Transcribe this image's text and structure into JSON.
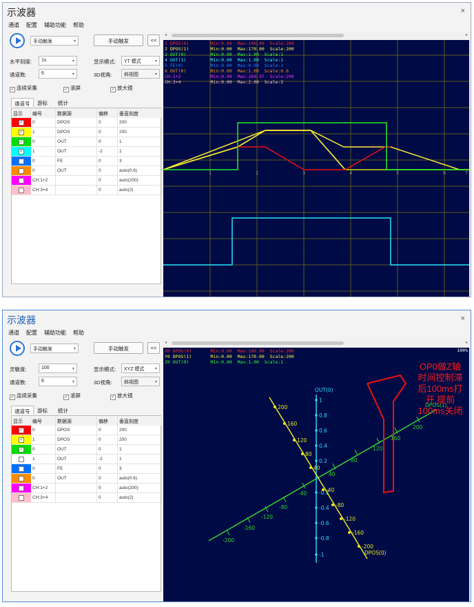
{
  "windows": [
    {
      "title": "示波器",
      "close": "×",
      "menu": [
        "通道",
        "配置",
        "辅助功能",
        "帮助"
      ],
      "trigger_mode": "手动触发",
      "manual_trigger_button": "手动触发",
      "collapse_button": "<<",
      "row1_label": "水平刻度:",
      "row1_value": "1s",
      "display_mode_label": "显示模式:",
      "display_mode_value": "YT 模式",
      "channels_label": "通道数:",
      "channels_value": "6",
      "view3d_label": "3D视角:",
      "view3d_value": "斜视图",
      "checks": [
        {
          "label": "连续采集",
          "checked": true
        },
        {
          "label": "滚屏",
          "checked": true
        },
        {
          "label": "放大镜",
          "checked": true
        }
      ],
      "tabs": [
        "通道号",
        "游标",
        "统计"
      ],
      "table_headers": [
        "显示",
        "编号",
        "数据源",
        "偏移",
        "垂直刻度"
      ],
      "rows": [
        {
          "color": "#ff0000",
          "checked": true,
          "num": "0",
          "src": "DPOS",
          "offset": "0",
          "scale": "200"
        },
        {
          "color": "#ffff00",
          "checked": true,
          "num": "1",
          "src": "DPOS",
          "offset": "0",
          "scale": "200"
        },
        {
          "color": "#00dd00",
          "checked": true,
          "num": "0",
          "src": "OUT",
          "offset": "0",
          "scale": "1"
        },
        {
          "color": "#00ffff",
          "checked": true,
          "num": "1",
          "src": "OUT",
          "offset": "-2",
          "scale": "1"
        },
        {
          "color": "#0070ff",
          "checked": false,
          "num": "0",
          "src": "FE",
          "offset": "0",
          "scale": "3"
        },
        {
          "color": "#ff8c00",
          "checked": false,
          "num": "0",
          "src": "OUT",
          "offset": "0",
          "scale": "auto(0.6)"
        },
        {
          "color": "#ff00ff",
          "checked": false,
          "num": "CH:1+2",
          "src": "",
          "offset": "0",
          "scale": "auto(200)"
        },
        {
          "color": "#ffc0cb",
          "checked": false,
          "num": "CH:3+4",
          "src": "",
          "offset": "0",
          "scale": "auto(2)"
        }
      ],
      "legend": [
        {
          "text": "1 DPOS(0)        Min:0.00  Max:100.00  Scale:200",
          "color": "#ff3030"
        },
        {
          "text": "2 DPOS(1)        Min:0.00  Max:170.00  Scale:200",
          "color": "#ffff40"
        },
        {
          "text": "3 OUT(0)         Min:0.00  Max:1.00  Scale:1",
          "color": "#30ff30"
        },
        {
          "text": "4 OUT(1)         Min:0.00  Max:1.00  Scale:1",
          "color": "#30ffff"
        },
        {
          "text": "5 FE(0)          Min:0.00  Max:0.00  Scale:3",
          "color": "#3080ff"
        },
        {
          "text": "6 OUT(0)         Min:0.00  Max:1.00  Scale:0.6",
          "color": "#ff9020"
        },
        {
          "text": "CH:1+2           Min:0.00  Max:269.97  Scale:200",
          "color": "#ff30ff"
        },
        {
          "text": "CH:3+4           Min:0.00  Max:2.00  Scale:2",
          "color": "#ffc0cb"
        }
      ],
      "x_ticks": [
        "1",
        "2",
        "3",
        "4",
        "5",
        "6",
        "7"
      ]
    },
    {
      "title": "示波器",
      "close": "×",
      "menu": [
        "通道",
        "配置",
        "辅助功能",
        "帮助"
      ],
      "trigger_mode": "手动触发",
      "manual_trigger_button": "手动触发",
      "collapse_button": "<<",
      "row1_label": "灵敏度:",
      "row1_value": "100",
      "display_mode_label": "显示模式:",
      "display_mode_value": "XYZ 模式",
      "channels_label": "通道数:",
      "channels_value": "6",
      "view3d_label": "3D视角:",
      "view3d_value": "斜视图",
      "checks": [
        {
          "label": "连续采集",
          "checked": true
        },
        {
          "label": "滚屏",
          "checked": true
        },
        {
          "label": "放大镜",
          "checked": true
        }
      ],
      "tabs": [
        "通道号",
        "游标",
        "统计"
      ],
      "table_headers": [
        "显示",
        "编号",
        "数据源",
        "偏移",
        "垂直刻度"
      ],
      "rows": [
        {
          "color": "#ff0000",
          "checked": true,
          "num": "0",
          "src": "DPOS",
          "offset": "0",
          "scale": "200"
        },
        {
          "color": "#ffff00",
          "checked": true,
          "num": "1",
          "src": "DPOS",
          "offset": "0",
          "scale": "200"
        },
        {
          "color": "#00dd00",
          "checked": true,
          "num": "0",
          "src": "OUT",
          "offset": "0",
          "scale": "1"
        },
        {
          "color": "#ffffff",
          "checked": false,
          "num": "1",
          "src": "OUT",
          "offset": "-2",
          "scale": "1"
        },
        {
          "color": "#0070ff",
          "checked": false,
          "num": "0",
          "src": "FE",
          "offset": "0",
          "scale": "3"
        },
        {
          "color": "#ff8c00",
          "checked": false,
          "num": "0",
          "src": "OUT",
          "offset": "0",
          "scale": "auto(0.6)"
        },
        {
          "color": "#ff00ff",
          "checked": false,
          "num": "CH:1+2",
          "src": "",
          "offset": "0",
          "scale": "auto(200)"
        },
        {
          "color": "#ffc0cb",
          "checked": false,
          "num": "CH:3+4",
          "src": "",
          "offset": "0",
          "scale": "auto(2)"
        }
      ],
      "legend": [
        {
          "text": "X0 DPOS(0)       Min:0.00  Max:100.00  Scale:200",
          "color": "#ff3030"
        },
        {
          "text": "Y0 DPOS(1)       Min:0.00  Max:170.00  Scale:200",
          "color": "#ffff40"
        },
        {
          "text": "Z0 OUT(0)        Min:0.00  Max:1.00  Scale:1",
          "color": "#30ff30"
        }
      ],
      "zoom": "100%",
      "annotation": [
        "OP0做Z轴",
        "时间控制滞",
        "后100ms打",
        "开,提前",
        "100ms关闭"
      ],
      "axis_labels": {
        "z": "OUT(0)",
        "x": "DPOS(1)",
        "y": "DPOS(0)"
      },
      "x_axis_ticks": [
        "-200",
        "-160",
        "-120",
        "-80",
        "-40",
        "40",
        "80",
        "120",
        "160",
        "200"
      ],
      "z_axis_ticks": [
        "1",
        "0.8",
        "0.6",
        "0.4",
        "0.2",
        "-0.2",
        "-0.4",
        "-0.6",
        "-0.8",
        "-1"
      ],
      "y_axis_ticks": [
        "200",
        "160",
        "120",
        "80",
        "40",
        "-40",
        "-80",
        "-120",
        "-160",
        "-200"
      ]
    }
  ],
  "colors": {
    "plot_bg": "#000a45",
    "grid": "#5a5a1a",
    "accent": "#2a72d6"
  }
}
